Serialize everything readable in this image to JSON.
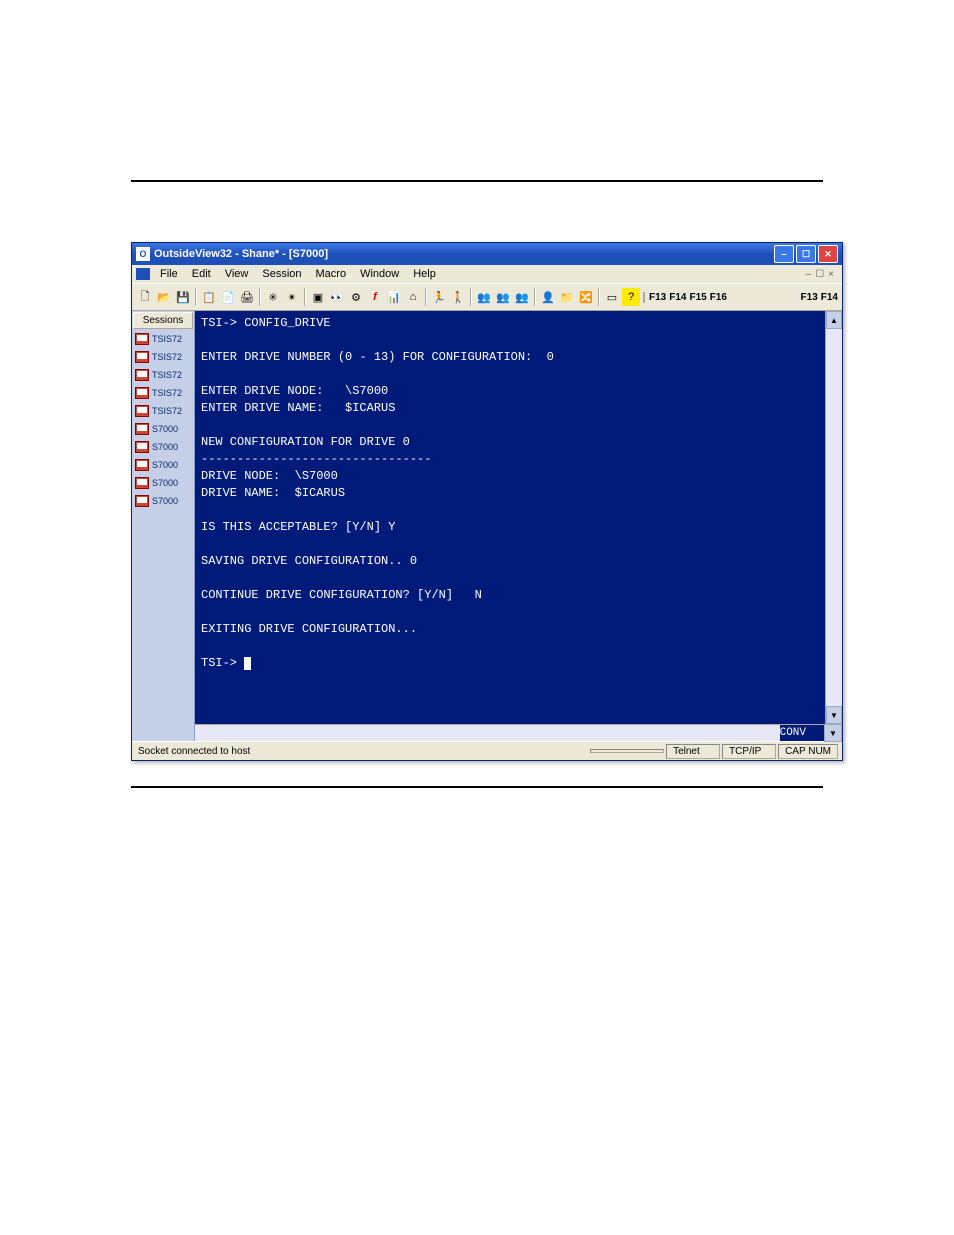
{
  "titlebar": {
    "title": "OutsideView32 - Shane* - [S7000]"
  },
  "menu": {
    "items": [
      "File",
      "Edit",
      "View",
      "Session",
      "Macro",
      "Window",
      "Help"
    ],
    "mdi": [
      "–",
      "☐",
      "×"
    ]
  },
  "toolbar": {
    "fkeys_left": [
      "F13",
      "F14",
      "F15",
      "F16"
    ],
    "fkeys_right": [
      "F13",
      "F14"
    ]
  },
  "sidebar": {
    "header": "Sessions",
    "items": [
      {
        "label": "TSIS72"
      },
      {
        "label": "TSIS72"
      },
      {
        "label": "TSIS72"
      },
      {
        "label": "TSIS72"
      },
      {
        "label": "TSIS72"
      },
      {
        "label": "S7000"
      },
      {
        "label": "S7000"
      },
      {
        "label": "S7000"
      },
      {
        "label": "S7000"
      },
      {
        "label": "S7000"
      }
    ]
  },
  "terminal": {
    "lines": [
      "TSI-> CONFIG_DRIVE",
      "",
      "ENTER DRIVE NUMBER (0 - 13) FOR CONFIGURATION:  0",
      "",
      "ENTER DRIVE NODE:   \\S7000",
      "ENTER DRIVE NAME:   $ICARUS",
      "",
      "NEW CONFIGURATION FOR DRIVE 0",
      "--------------------------------",
      "DRIVE NODE:  \\S7000",
      "DRIVE NAME:  $ICARUS",
      "",
      "IS THIS ACCEPTABLE? [Y/N] Y",
      "",
      "SAVING DRIVE CONFIGURATION.. 0",
      "",
      "CONTINUE DRIVE CONFIGURATION? [Y/N]   N",
      "",
      "EXITING DRIVE CONFIGURATION...",
      ""
    ],
    "prompt": "TSI-> ",
    "conv": "CONV"
  },
  "statusbar": {
    "left": "Socket connected to host",
    "cells": [
      "",
      "Telnet",
      "TCP/IP",
      "CAP  NUM"
    ]
  }
}
